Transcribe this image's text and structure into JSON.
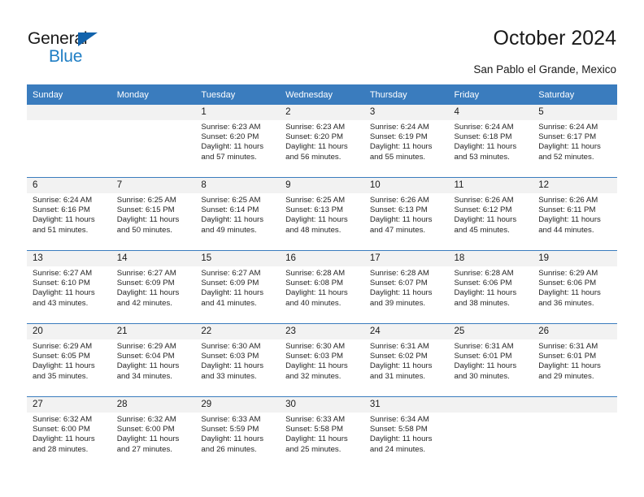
{
  "brand": {
    "name_top": "General",
    "name_bottom": "Blue",
    "accent_color": "#1263ac",
    "blue_color": "#1f7ec4"
  },
  "header": {
    "title": "October 2024",
    "subtitle": "San Pablo el Grande, Mexico",
    "header_bg": "#3a7cbe"
  },
  "calendar": {
    "weekday_headers": [
      "Sunday",
      "Monday",
      "Tuesday",
      "Wednesday",
      "Thursday",
      "Friday",
      "Saturday"
    ],
    "labels": {
      "sunrise": "Sunrise:",
      "sunset": "Sunset:",
      "daylight": "Daylight:"
    },
    "weeks": [
      [
        {
          "day": ""
        },
        {
          "day": ""
        },
        {
          "day": "1",
          "sunrise": "Sunrise: 6:23 AM",
          "sunset": "Sunset: 6:20 PM",
          "daylight": "Daylight: 11 hours and 57 minutes."
        },
        {
          "day": "2",
          "sunrise": "Sunrise: 6:23 AM",
          "sunset": "Sunset: 6:20 PM",
          "daylight": "Daylight: 11 hours and 56 minutes."
        },
        {
          "day": "3",
          "sunrise": "Sunrise: 6:24 AM",
          "sunset": "Sunset: 6:19 PM",
          "daylight": "Daylight: 11 hours and 55 minutes."
        },
        {
          "day": "4",
          "sunrise": "Sunrise: 6:24 AM",
          "sunset": "Sunset: 6:18 PM",
          "daylight": "Daylight: 11 hours and 53 minutes."
        },
        {
          "day": "5",
          "sunrise": "Sunrise: 6:24 AM",
          "sunset": "Sunset: 6:17 PM",
          "daylight": "Daylight: 11 hours and 52 minutes."
        }
      ],
      [
        {
          "day": "6",
          "sunrise": "Sunrise: 6:24 AM",
          "sunset": "Sunset: 6:16 PM",
          "daylight": "Daylight: 11 hours and 51 minutes."
        },
        {
          "day": "7",
          "sunrise": "Sunrise: 6:25 AM",
          "sunset": "Sunset: 6:15 PM",
          "daylight": "Daylight: 11 hours and 50 minutes."
        },
        {
          "day": "8",
          "sunrise": "Sunrise: 6:25 AM",
          "sunset": "Sunset: 6:14 PM",
          "daylight": "Daylight: 11 hours and 49 minutes."
        },
        {
          "day": "9",
          "sunrise": "Sunrise: 6:25 AM",
          "sunset": "Sunset: 6:13 PM",
          "daylight": "Daylight: 11 hours and 48 minutes."
        },
        {
          "day": "10",
          "sunrise": "Sunrise: 6:26 AM",
          "sunset": "Sunset: 6:13 PM",
          "daylight": "Daylight: 11 hours and 47 minutes."
        },
        {
          "day": "11",
          "sunrise": "Sunrise: 6:26 AM",
          "sunset": "Sunset: 6:12 PM",
          "daylight": "Daylight: 11 hours and 45 minutes."
        },
        {
          "day": "12",
          "sunrise": "Sunrise: 6:26 AM",
          "sunset": "Sunset: 6:11 PM",
          "daylight": "Daylight: 11 hours and 44 minutes."
        }
      ],
      [
        {
          "day": "13",
          "sunrise": "Sunrise: 6:27 AM",
          "sunset": "Sunset: 6:10 PM",
          "daylight": "Daylight: 11 hours and 43 minutes."
        },
        {
          "day": "14",
          "sunrise": "Sunrise: 6:27 AM",
          "sunset": "Sunset: 6:09 PM",
          "daylight": "Daylight: 11 hours and 42 minutes."
        },
        {
          "day": "15",
          "sunrise": "Sunrise: 6:27 AM",
          "sunset": "Sunset: 6:09 PM",
          "daylight": "Daylight: 11 hours and 41 minutes."
        },
        {
          "day": "16",
          "sunrise": "Sunrise: 6:28 AM",
          "sunset": "Sunset: 6:08 PM",
          "daylight": "Daylight: 11 hours and 40 minutes."
        },
        {
          "day": "17",
          "sunrise": "Sunrise: 6:28 AM",
          "sunset": "Sunset: 6:07 PM",
          "daylight": "Daylight: 11 hours and 39 minutes."
        },
        {
          "day": "18",
          "sunrise": "Sunrise: 6:28 AM",
          "sunset": "Sunset: 6:06 PM",
          "daylight": "Daylight: 11 hours and 38 minutes."
        },
        {
          "day": "19",
          "sunrise": "Sunrise: 6:29 AM",
          "sunset": "Sunset: 6:06 PM",
          "daylight": "Daylight: 11 hours and 36 minutes."
        }
      ],
      [
        {
          "day": "20",
          "sunrise": "Sunrise: 6:29 AM",
          "sunset": "Sunset: 6:05 PM",
          "daylight": "Daylight: 11 hours and 35 minutes."
        },
        {
          "day": "21",
          "sunrise": "Sunrise: 6:29 AM",
          "sunset": "Sunset: 6:04 PM",
          "daylight": "Daylight: 11 hours and 34 minutes."
        },
        {
          "day": "22",
          "sunrise": "Sunrise: 6:30 AM",
          "sunset": "Sunset: 6:03 PM",
          "daylight": "Daylight: 11 hours and 33 minutes."
        },
        {
          "day": "23",
          "sunrise": "Sunrise: 6:30 AM",
          "sunset": "Sunset: 6:03 PM",
          "daylight": "Daylight: 11 hours and 32 minutes."
        },
        {
          "day": "24",
          "sunrise": "Sunrise: 6:31 AM",
          "sunset": "Sunset: 6:02 PM",
          "daylight": "Daylight: 11 hours and 31 minutes."
        },
        {
          "day": "25",
          "sunrise": "Sunrise: 6:31 AM",
          "sunset": "Sunset: 6:01 PM",
          "daylight": "Daylight: 11 hours and 30 minutes."
        },
        {
          "day": "26",
          "sunrise": "Sunrise: 6:31 AM",
          "sunset": "Sunset: 6:01 PM",
          "daylight": "Daylight: 11 hours and 29 minutes."
        }
      ],
      [
        {
          "day": "27",
          "sunrise": "Sunrise: 6:32 AM",
          "sunset": "Sunset: 6:00 PM",
          "daylight": "Daylight: 11 hours and 28 minutes."
        },
        {
          "day": "28",
          "sunrise": "Sunrise: 6:32 AM",
          "sunset": "Sunset: 6:00 PM",
          "daylight": "Daylight: 11 hours and 27 minutes."
        },
        {
          "day": "29",
          "sunrise": "Sunrise: 6:33 AM",
          "sunset": "Sunset: 5:59 PM",
          "daylight": "Daylight: 11 hours and 26 minutes."
        },
        {
          "day": "30",
          "sunrise": "Sunrise: 6:33 AM",
          "sunset": "Sunset: 5:58 PM",
          "daylight": "Daylight: 11 hours and 25 minutes."
        },
        {
          "day": "31",
          "sunrise": "Sunrise: 6:34 AM",
          "sunset": "Sunset: 5:58 PM",
          "daylight": "Daylight: 11 hours and 24 minutes."
        },
        {
          "day": ""
        },
        {
          "day": ""
        }
      ]
    ]
  }
}
